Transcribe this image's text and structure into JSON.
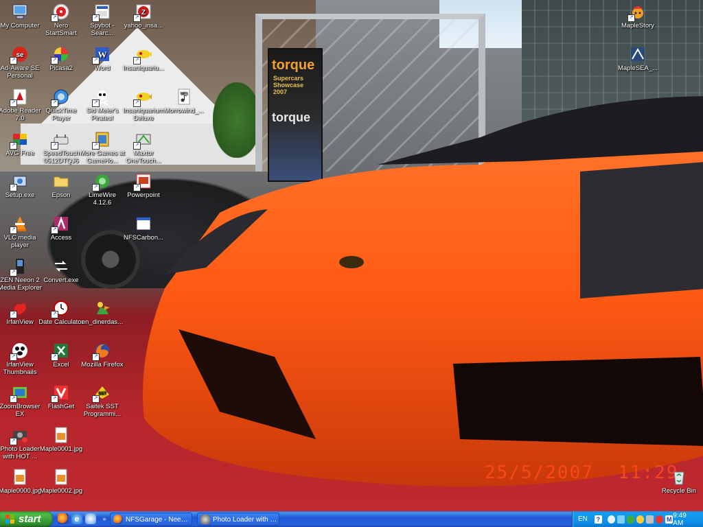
{
  "desktop": {
    "icons": [
      {
        "label": "My Computer",
        "icon": "my-computer-icon",
        "shortcut": false
      },
      {
        "label": "Ad-Aware SE Personal",
        "icon": "ad-aware-icon",
        "shortcut": true
      },
      {
        "label": "Adobe Reader 7.0",
        "icon": "adobe-reader-icon",
        "shortcut": true
      },
      {
        "label": "AVG Free",
        "icon": "avg-icon",
        "shortcut": true
      },
      {
        "label": "Setup.exe",
        "icon": "setup-icon",
        "shortcut": true
      },
      {
        "label": "VLC media player",
        "icon": "vlc-icon",
        "shortcut": true
      },
      {
        "label": "ZEN Neeon 2 Media Explorer",
        "icon": "zen-player-icon",
        "shortcut": true
      },
      {
        "label": "IrfanView",
        "icon": "irfanview-icon",
        "shortcut": true
      },
      {
        "label": "IrfanView Thumbnails",
        "icon": "irfanview-thumbnails-icon",
        "shortcut": true
      },
      {
        "label": "ZoomBrowser EX",
        "icon": "zoombrowser-icon",
        "shortcut": true
      },
      {
        "label": "Photo Loader with HOT ...",
        "icon": "photo-loader-icon",
        "shortcut": true
      },
      {
        "label": "Maple0000.jpg",
        "icon": "jpg-file-icon",
        "shortcut": false
      },
      {
        "label": "Nero StartSmart",
        "icon": "nero-icon",
        "shortcut": true
      },
      {
        "label": "Picasa2",
        "icon": "picasa-icon",
        "shortcut": true
      },
      {
        "label": "QuickTime Player",
        "icon": "quicktime-icon",
        "shortcut": true
      },
      {
        "label": "SpeedTouch 0512DTQJ6",
        "icon": "speedtouch-icon",
        "shortcut": true
      },
      {
        "label": "Epson",
        "icon": "folder-icon",
        "shortcut": false
      },
      {
        "label": "Access",
        "icon": "access-icon",
        "shortcut": true
      },
      {
        "label": "Convert.exe",
        "icon": "convert-icon",
        "shortcut": false
      },
      {
        "label": "Date Calculator",
        "icon": "clock-icon",
        "shortcut": true
      },
      {
        "label": "Excel",
        "icon": "excel-icon",
        "shortcut": true
      },
      {
        "label": "FlashGet",
        "icon": "flashget-icon",
        "shortcut": true
      },
      {
        "label": "Maple0001.jpg",
        "icon": "jpg-file-icon",
        "shortcut": false
      },
      {
        "label": "Maple0002.jpg",
        "icon": "jpg-file-icon",
        "shortcut": false
      },
      {
        "label": "Spybot - Searc...",
        "icon": "spybot-icon",
        "shortcut": true
      },
      {
        "label": "Word",
        "icon": "word-icon",
        "shortcut": true
      },
      {
        "label": "Sid Meier's Pirates!",
        "icon": "pirates-icon",
        "shortcut": true
      },
      {
        "label": "More Games at GameHo...",
        "icon": "games-icon",
        "shortcut": true
      },
      {
        "label": "LimeWire 4.12.6",
        "icon": "limewire-icon",
        "shortcut": true
      },
      {
        "label": "en_dinerdas...",
        "icon": "dinerdash-icon",
        "shortcut": false
      },
      {
        "label": "Mozilla Firefox",
        "icon": "firefox-icon",
        "shortcut": true
      },
      {
        "label": "Saitek SST Programmi...",
        "icon": "saitek-icon",
        "shortcut": true
      },
      {
        "label": "yahoo_insa...",
        "icon": "yahoo-insa-icon",
        "shortcut": true
      },
      {
        "label": "Insaniquariu...",
        "icon": "insaniquarium-icon",
        "shortcut": true
      },
      {
        "label": "Insaniquarium Deluxe",
        "icon": "insaniquarium-deluxe-icon",
        "shortcut": true
      },
      {
        "label": "Maxtor OneTouch...",
        "icon": "maxtor-icon",
        "shortcut": true
      },
      {
        "label": "Powerpoint",
        "icon": "powerpoint-icon",
        "shortcut": true
      },
      {
        "label": "NFSCarbon...",
        "icon": "window-icon",
        "shortcut": false
      },
      {
        "label": "Morrowind_...",
        "icon": "mp3-file-icon",
        "shortcut": false
      },
      {
        "label": "MapleStory",
        "icon": "maplestory-icon",
        "shortcut": true
      },
      {
        "label": "MapleSEA_...",
        "icon": "maplesea-icon",
        "shortcut": false
      },
      {
        "label": "Recycle Bin",
        "icon": "recycle-bin-icon",
        "shortcut": false
      }
    ]
  },
  "wallpaper": {
    "banner_title": "torque",
    "banner_subtitle": "Supercars Showcase 2007",
    "banner_title_2": "torque",
    "date_stamp": "25/5/2007",
    "time_stamp": "11:29"
  },
  "taskbar": {
    "start_label": "start",
    "quick_launch": [
      "firefox-icon",
      "ie-icon",
      "media-player-icon",
      "expand-icon"
    ],
    "tasks": [
      {
        "label": "NFSGarage - Need Fo...",
        "icon": "firefox-icon"
      },
      {
        "label": "Photo Loader with H...",
        "icon": "photo-loader-icon"
      }
    ],
    "tray": {
      "language": "EN",
      "clock": "9:49 AM"
    }
  },
  "colors": {
    "taskbar_blue": "#2157d7",
    "start_green": "#3c9e3c",
    "tray_blue": "#0f8fe8",
    "car_orange": "#ff5a14"
  }
}
